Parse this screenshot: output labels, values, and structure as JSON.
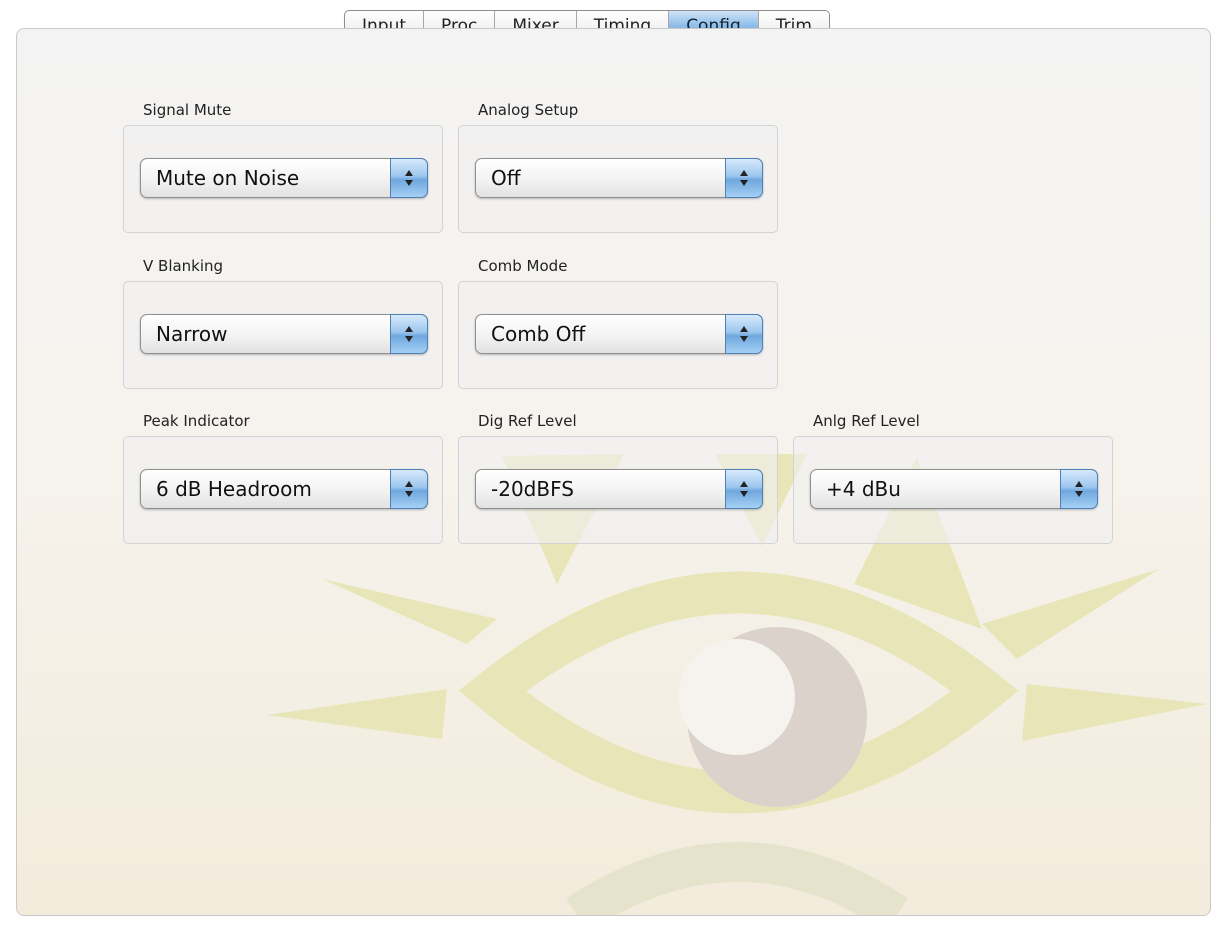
{
  "tabs": [
    {
      "label": "Input"
    },
    {
      "label": "Proc"
    },
    {
      "label": "Mixer"
    },
    {
      "label": "Timing"
    },
    {
      "label": "Config",
      "active": true
    },
    {
      "label": "Trim"
    }
  ],
  "config": {
    "signal_mute": {
      "label": "Signal Mute",
      "value": "Mute on Noise"
    },
    "analog_setup": {
      "label": "Analog Setup",
      "value": "Off"
    },
    "v_blanking": {
      "label": "V Blanking",
      "value": "Narrow"
    },
    "comb_mode": {
      "label": "Comb Mode",
      "value": "Comb Off"
    },
    "peak_indicator": {
      "label": "Peak Indicator",
      "value": "6 dB Headroom"
    },
    "dig_ref_level": {
      "label": "Dig Ref Level",
      "value": "-20dBFS"
    },
    "anlg_ref_level": {
      "label": "Anlg Ref Level",
      "value": "+4 dBu"
    }
  },
  "icons": {
    "select_arrows": "updown-arrows-icon",
    "watermark": "eye-logo-watermark"
  },
  "colors": {
    "accent_blue": "#77addf",
    "watermark_green": "#e6e4b4",
    "watermark_pupil": "#d9d3cc"
  }
}
